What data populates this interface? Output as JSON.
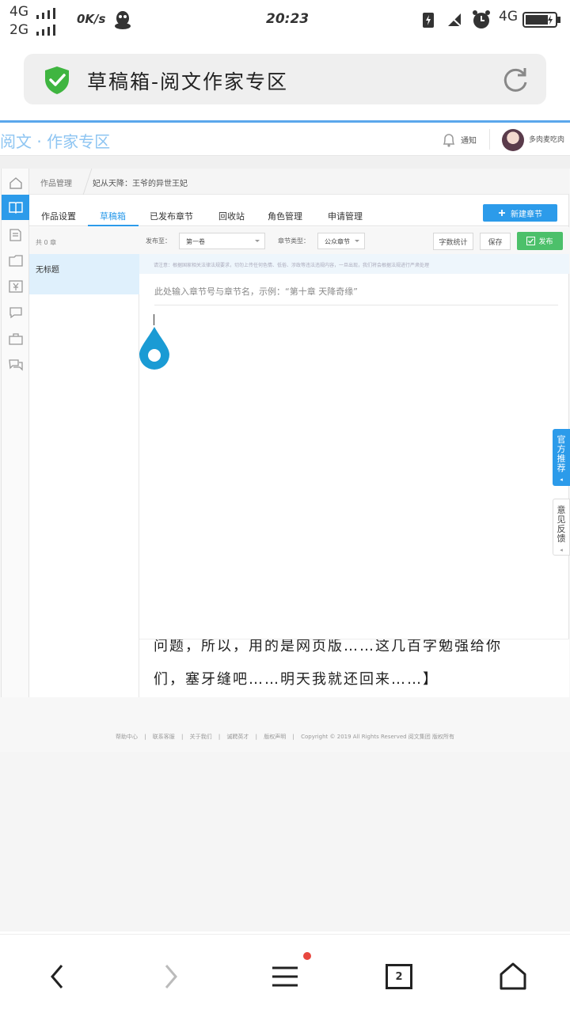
{
  "status_bar": {
    "net1": "4G",
    "net2": "2G",
    "speed": "0K/s",
    "time": "20:23",
    "net3": "4G",
    "icons": [
      "qq-icon",
      "battery-charging-icon",
      "mute-icon",
      "alarm-icon",
      "battery-icon"
    ]
  },
  "browser": {
    "title": "草稿箱-阅文作家专区",
    "shield_color": "#3fb540"
  },
  "site": {
    "logo": "阅文 · 作家专区",
    "notify": "通知",
    "username": "多肉麦吃肉"
  },
  "breadcrumb": {
    "root": "作品管理",
    "work": "妃从天降：王爷的异世王妃"
  },
  "tabs": [
    {
      "label": "作品设置"
    },
    {
      "label": "草稿箱"
    },
    {
      "label": "已发布章节"
    },
    {
      "label": "回收站"
    },
    {
      "label": "角色管理"
    },
    {
      "label": "申请管理"
    }
  ],
  "new_chapter_label": "新建章节",
  "chapter_list": {
    "count": "共 0 章",
    "items": [
      {
        "title": "无标题"
      }
    ]
  },
  "editor": {
    "publish_to_label": "发布至：",
    "volume": "第一卷",
    "chapter_type_label": "章节类型：",
    "chapter_type": "公众章节",
    "word_count_label": "字数统计",
    "save_label": "保存",
    "publish_label": "发布",
    "notice": "请注意：根据国家相关法律法规要求，切勿上传任何色情、低俗、涉政等违法违规内容，一旦出现，我们将会根据法规进行严肃处理",
    "title_hint": "此处输入章节号与章节名，示例：“第十章 天降奇缘”",
    "body_line1": "问题，所以，用的是网页版……这几百字勉强给你",
    "body_line2": "们，塞牙缝吧……明天我就还回来……】"
  },
  "side_floats": {
    "recommend": "官方推荐",
    "feedback": "意见反馈"
  },
  "footer": {
    "links": [
      "帮助中心",
      "联系客服",
      "关于我们",
      "诚聘英才",
      "版权声明"
    ],
    "copyright": "Copyright © 2019 All Rights Reserved 阅文集团 版权所有"
  },
  "navbar": {
    "tab_count": "2"
  },
  "colors": {
    "accent": "#2c9bea",
    "publish": "#4cc06a",
    "badge": "#e8473f"
  }
}
